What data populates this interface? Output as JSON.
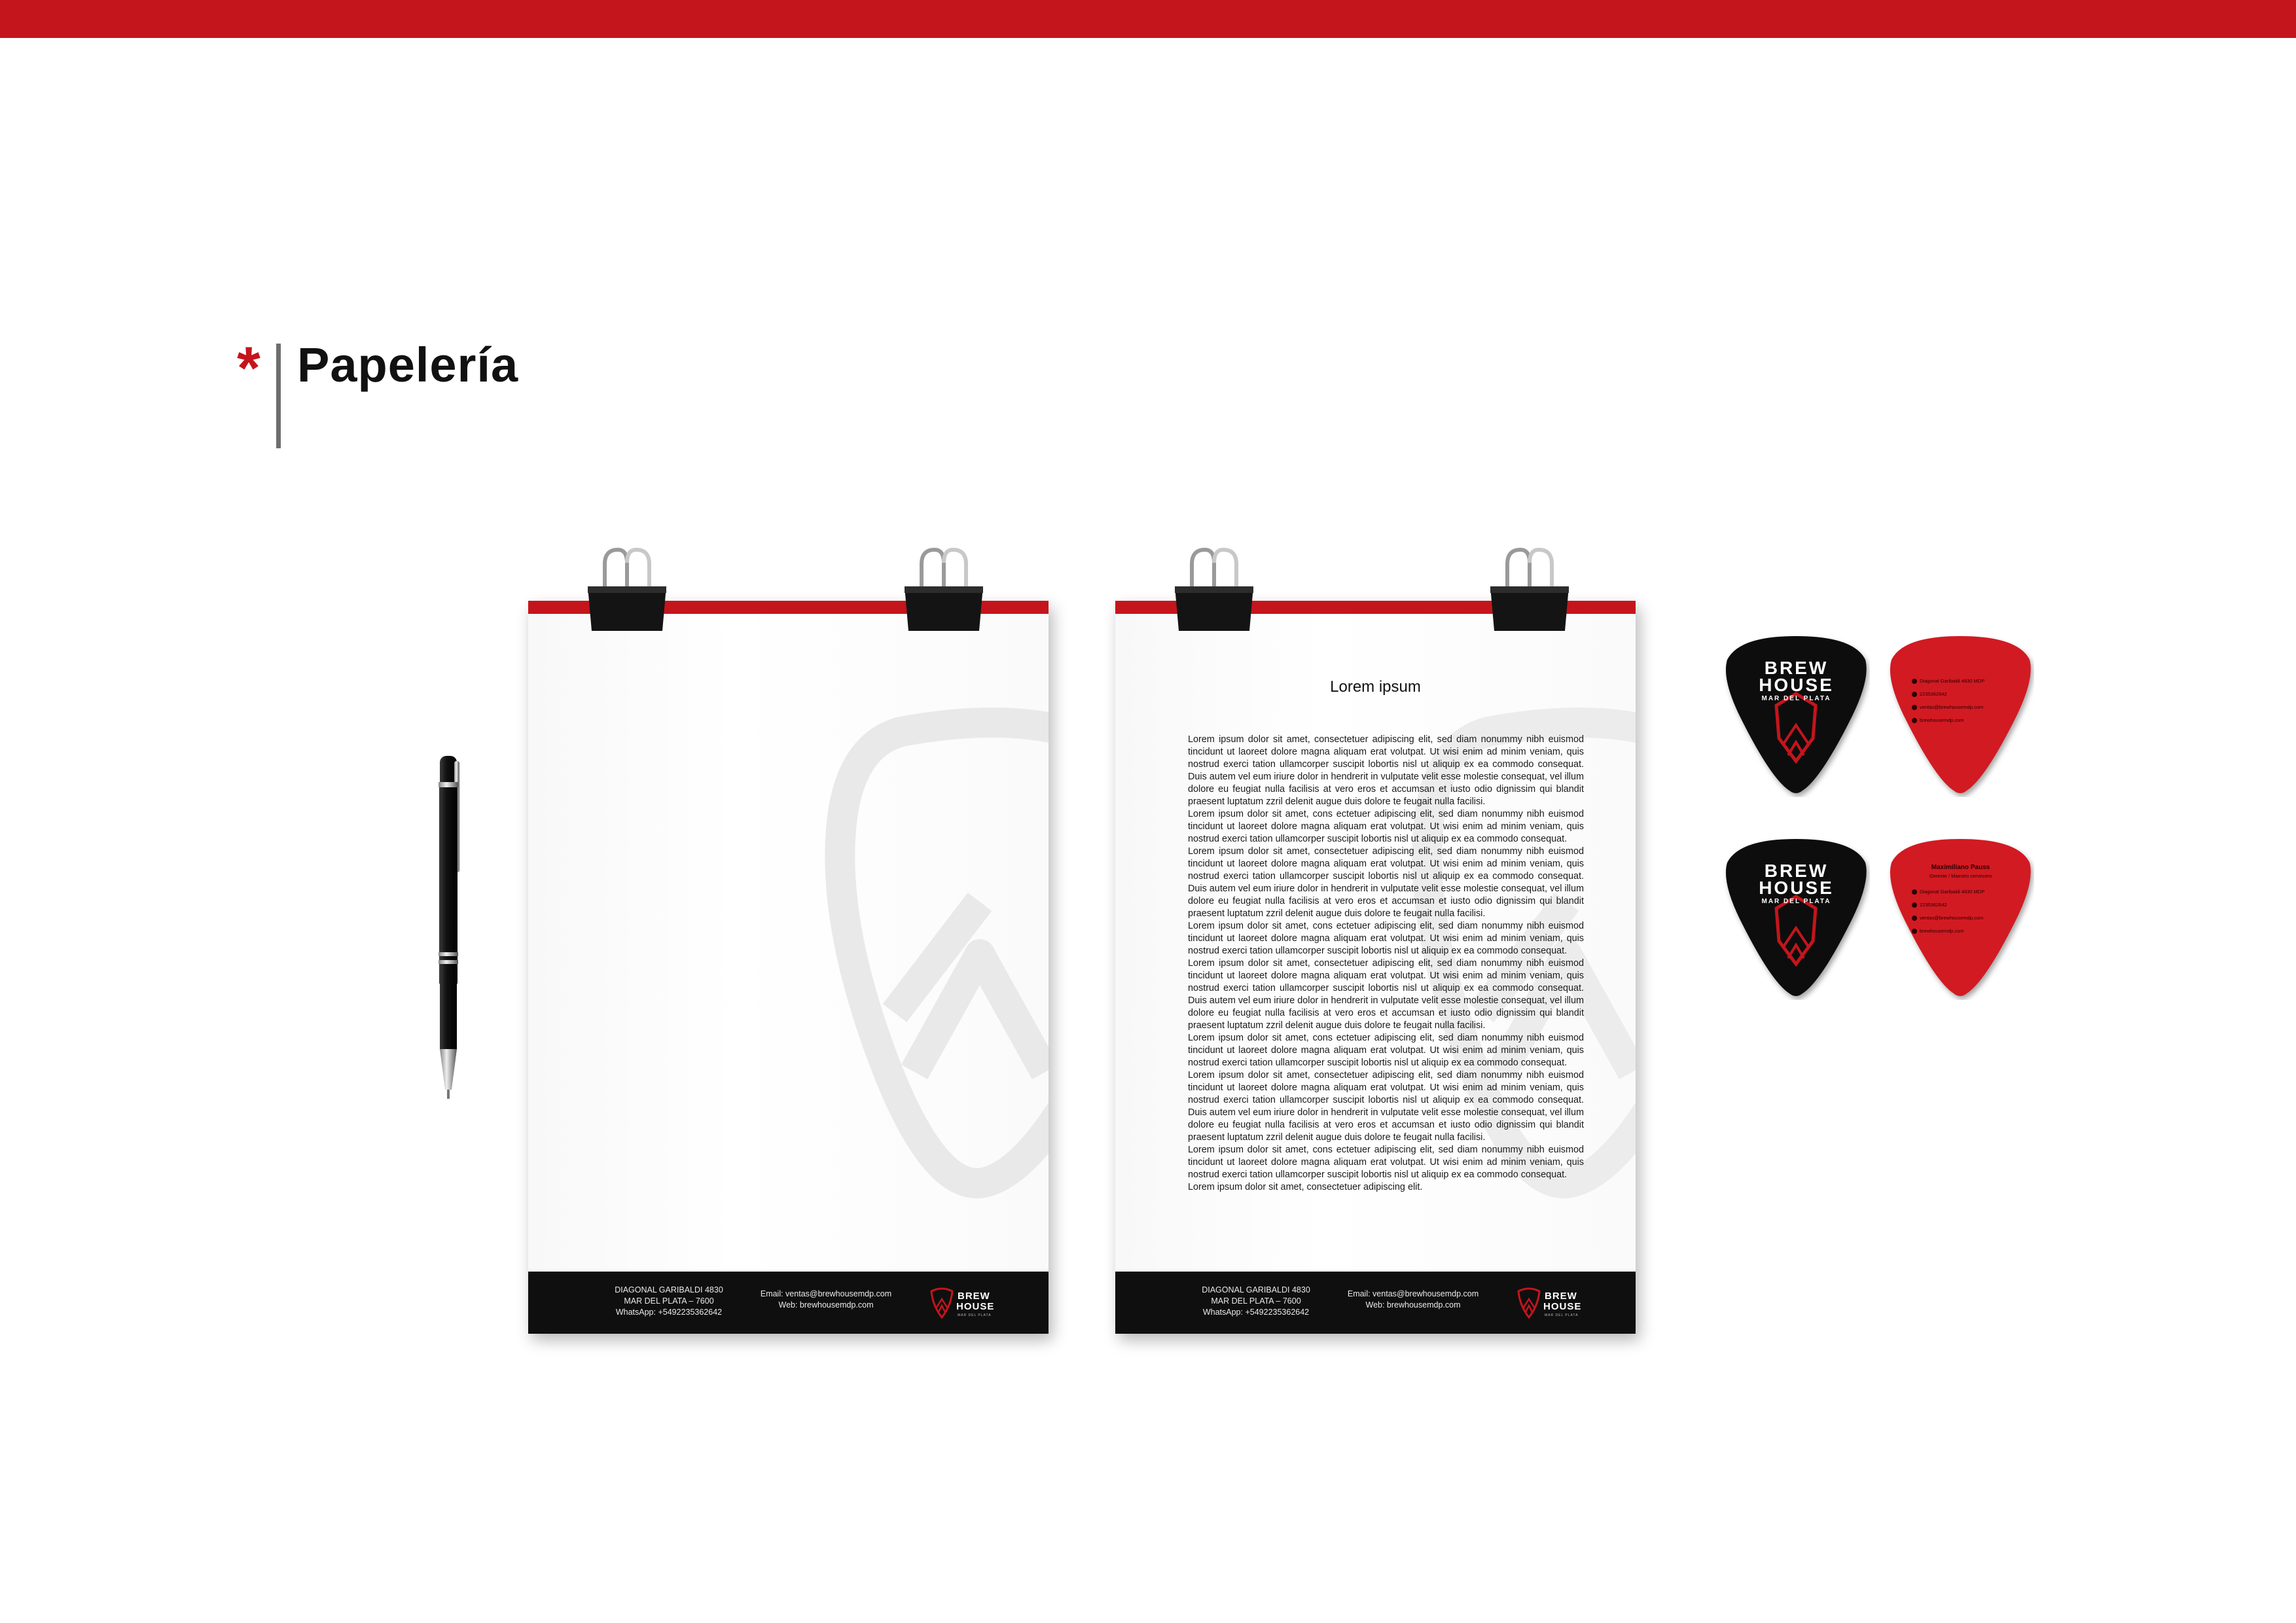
{
  "colors": {
    "brand_red": "#c4151c",
    "black": "#0f0f0f",
    "gray_rule": "#6e6e6e"
  },
  "heading": {
    "marker": "*",
    "title": "Papelería"
  },
  "footer": {
    "address_line1": "DIAGONAL GARIBALDI 4830",
    "address_line2": "MAR DEL PLATA – 7600",
    "address_line3": "WhatsApp: +5492235362642",
    "email": "Email: ventas@brewhousemdp.com",
    "web": "Web: brewhousemdp.com"
  },
  "logo": {
    "word1": "BREW",
    "word2": "HOUSE",
    "word3": "MAR DEL PLATA"
  },
  "letterhead_text": {
    "title": "Lorem ipsum",
    "body": "Lorem ipsum dolor sit amet, consectetuer adipiscing elit, sed diam nonummy nibh euismod tincidunt ut laoreet dolore magna aliquam erat volutpat. Ut wisi enim ad minim veniam, quis nostrud exerci tation ullamcorper suscipit lobortis nisl ut aliquip ex ea commodo consequat. Duis autem vel eum iriure dolor in hendrerit in vulputate velit esse molestie consequat, vel illum dolore eu feugiat nulla facilisis at vero eros et accumsan et iusto odio dignissim qui blandit praesent luptatum zzril delenit augue duis dolore te feugait nulla facilisi.\nLorem ipsum dolor sit amet, cons ectetuer adipiscing elit, sed diam nonummy nibh euismod tincidunt ut laoreet dolore magna aliquam erat volutpat. Ut wisi enim ad minim veniam, quis nostrud exerci tation ullamcorper suscipit lobortis nisl ut aliquip ex ea commodo consequat.\nLorem ipsum dolor sit amet, consectetuer adipiscing elit, sed diam nonummy nibh euismod tincidunt ut laoreet dolore magna aliquam erat volutpat. Ut wisi enim ad minim veniam, quis nostrud exerci tation ullamcorper suscipit lobortis nisl ut aliquip ex ea commodo consequat. Duis autem vel eum iriure dolor in hendrerit in vulputate velit esse molestie consequat, vel illum dolore eu feugiat nulla facilisis at vero eros et accumsan et iusto odio dignissim qui blandit praesent luptatum zzril delenit augue duis dolore te feugait nulla facilisi.\nLorem ipsum dolor sit amet, cons ectetuer adipiscing elit, sed diam nonummy nibh euismod tincidunt ut laoreet dolore magna aliquam erat volutpat. Ut wisi enim ad minim veniam, quis nostrud exerci tation ullamcorper suscipit lobortis nisl ut aliquip ex ea commodo consequat.\nLorem ipsum dolor sit amet, consectetuer adipiscing elit, sed diam nonummy nibh euismod tincidunt ut laoreet dolore magna aliquam erat volutpat. Ut wisi enim ad minim veniam, quis nostrud exerci tation ullamcorper suscipit lobortis nisl ut aliquip ex ea commodo consequat. Duis autem vel eum iriure dolor in hendrerit in vulputate velit esse molestie consequat, vel illum dolore eu feugiat nulla facilisis at vero eros et accumsan et iusto odio dignissim qui blandit praesent luptatum zzril delenit augue duis dolore te feugait nulla facilisi.\nLorem ipsum dolor sit amet, cons ectetuer adipiscing elit, sed diam nonummy nibh euismod tincidunt ut laoreet dolore magna aliquam erat volutpat. Ut wisi enim ad minim veniam, quis nostrud exerci tation ullamcorper suscipit lobortis nisl ut aliquip ex ea commodo consequat.\nLorem ipsum dolor sit amet, consectetuer adipiscing elit, sed diam nonummy nibh euismod tincidunt ut laoreet dolore magna aliquam erat volutpat. Ut wisi enim ad minim veniam, quis nostrud exerci tation ullamcorper suscipit lobortis nisl ut aliquip ex ea commodo consequat. Duis autem vel eum iriure dolor in hendrerit in vulputate velit esse molestie consequat, vel illum dolore eu feugiat nulla facilisis at vero eros et accumsan et iusto odio dignissim qui blandit praesent luptatum zzril delenit augue duis dolore te feugait nulla facilisi.\nLorem ipsum dolor sit amet, cons ectetuer adipiscing elit, sed diam nonummy nibh euismod tincidunt ut laoreet dolore magna aliquam erat volutpat. Ut wisi enim ad minim veniam, quis nostrud exerci tation ullamcorper suscipit lobortis nisl ut aliquip ex ea commodo consequat.\nLorem ipsum dolor sit amet, consectetuer adipiscing elit."
  },
  "card_back": {
    "line1": "Diagonal Garibaldi 4830 MDP",
    "line2": "2235362642",
    "line3": "ventas@brewhousemdp.com",
    "line4": "brewhousemdp.com"
  },
  "card_back_personal": {
    "name": "Maximiliano Pauss",
    "role": "Gerente / Maestro cervecero",
    "line1": "Diagonal Garibaldi 4830 MDP",
    "line2": "2235362642",
    "line3": "ventas@brewhousemdp.com",
    "line4": "brewhousemdp.com"
  }
}
